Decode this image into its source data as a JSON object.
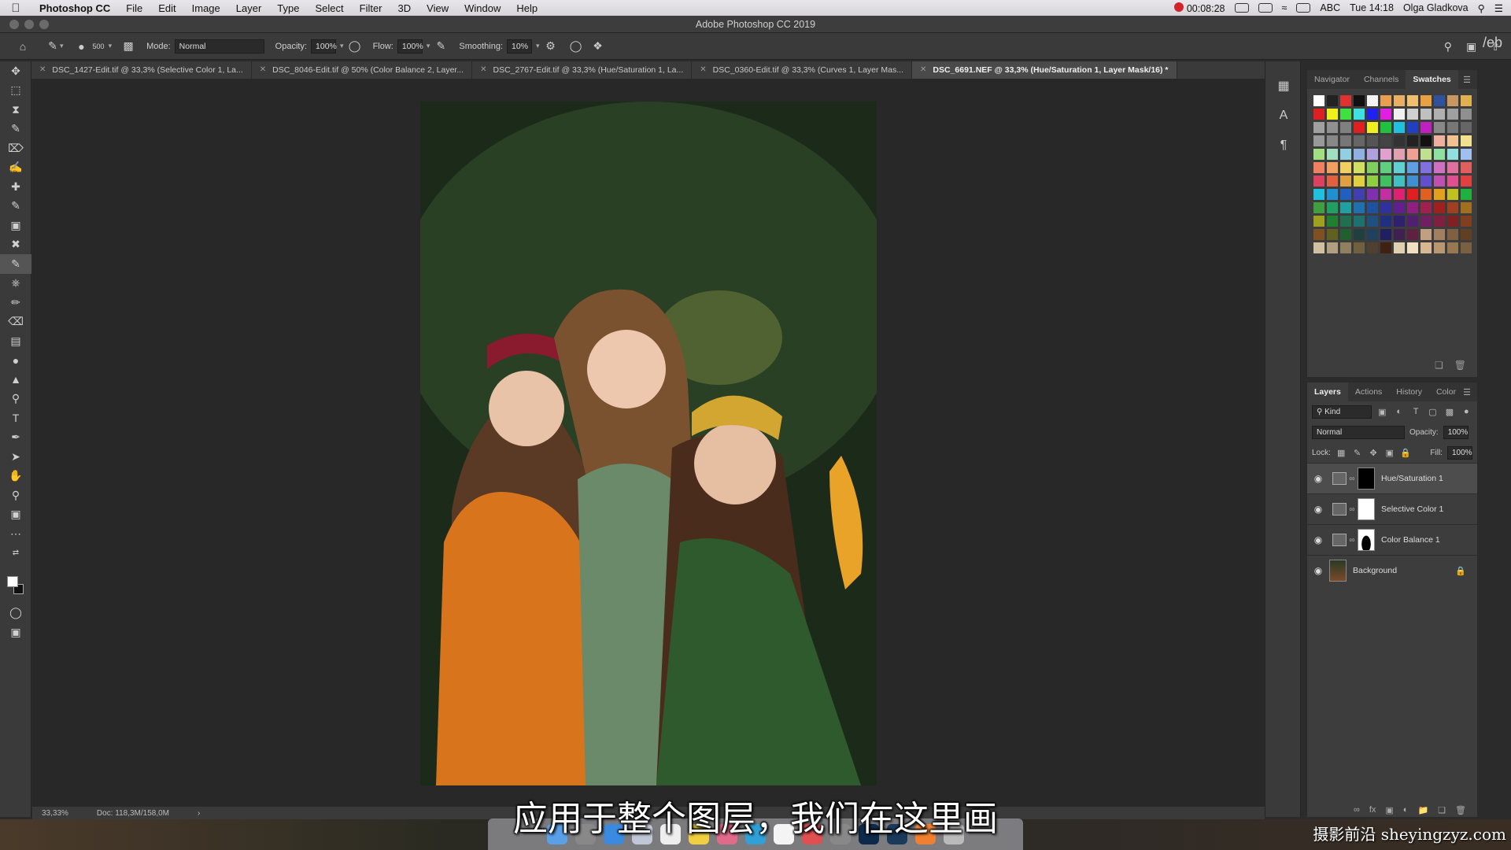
{
  "menubar": {
    "apple": "",
    "app_name": "Photoshop CC",
    "items": [
      "File",
      "Edit",
      "Image",
      "Layer",
      "Type",
      "Select",
      "Filter",
      "3D",
      "View",
      "Window",
      "Help"
    ],
    "recording_time": "00:08:28",
    "input_source": "ABC",
    "clock": "Tue 14:18",
    "user": "Olga Gladkova"
  },
  "window": {
    "title": "Adobe Photoshop CC 2019"
  },
  "options": {
    "brush_size": "500",
    "mode_label": "Mode:",
    "mode_value": "Normal",
    "opacity_label": "Opacity:",
    "opacity_value": "100%",
    "flow_label": "Flow:",
    "flow_value": "100%",
    "smoothing_label": "Smoothing:",
    "smoothing_value": "10%"
  },
  "tabs": [
    {
      "label": "DSC_1427-Edit.tif @ 33,3% (Selective Color 1, La...",
      "active": false
    },
    {
      "label": "DSC_8046-Edit.tif @ 50% (Color Balance 2, Layer...",
      "active": false
    },
    {
      "label": "DSC_2767-Edit.tif @ 33,3% (Hue/Saturation 1, La...",
      "active": false
    },
    {
      "label": "DSC_0360-Edit.tif @ 33,3% (Curves 1, Layer Mas...",
      "active": false
    },
    {
      "label": "DSC_6691.NEF @ 33,3% (Hue/Saturation 1, Layer Mask/16) *",
      "active": true
    }
  ],
  "statusbar": {
    "zoom": "33,33%",
    "doc": "Doc: 118,3M/158,0M"
  },
  "swatches_panel": {
    "tabs": [
      "Navigator",
      "Channels",
      "Swatches"
    ],
    "active_tab": "Swatches",
    "colors": [
      "#ffffff",
      "#222222",
      "#e03030",
      "#111111",
      "#f4f4f4",
      "#e8a050",
      "#e8b060",
      "#f0c070",
      "#e8a040",
      "#3050a0",
      "#c89860",
      "#e0b050",
      "#e02020",
      "#f0f020",
      "#40e040",
      "#40e0e0",
      "#2020f0",
      "#e020e0",
      "#f0f0f0",
      "#d0d0d0",
      "#c0c0c0",
      "#b0b0b0",
      "#a0a0a0",
      "#909090",
      "#a0a0a0",
      "#909090",
      "#808080",
      "#e02020",
      "#f0f020",
      "#20c040",
      "#20c0e0",
      "#2040c0",
      "#c020c0",
      "#888888",
      "#777777",
      "#666666",
      "#999999",
      "#888888",
      "#777777",
      "#666666",
      "#555555",
      "#444444",
      "#333333",
      "#222222",
      "#111111",
      "#f0b0a0",
      "#f0c090",
      "#f0e090",
      "#a0e080",
      "#a0e0c0",
      "#90d0e0",
      "#90b0e0",
      "#b0a0e0",
      "#e0a0d0",
      "#e0a0b0",
      "#f0a090",
      "#c0e090",
      "#90e0a0",
      "#90e0e0",
      "#a0c0f0",
      "#f08060",
      "#f0a060",
      "#f0d060",
      "#d0e060",
      "#80d060",
      "#60d080",
      "#60d0d0",
      "#60a0e0",
      "#8070e0",
      "#d070c0",
      "#e070a0",
      "#e06060",
      "#e04060",
      "#e06040",
      "#e0a040",
      "#e0d040",
      "#90d040",
      "#40c060",
      "#40c0c0",
      "#4090d0",
      "#6050d0",
      "#c050b0",
      "#e05090",
      "#e04040",
      "#20c0e0",
      "#2090d0",
      "#2060c0",
      "#4040b0",
      "#8030b0",
      "#c030a0",
      "#e02070",
      "#e02020",
      "#e06020",
      "#e0a020",
      "#c0c020",
      "#20b040",
      "#40a040",
      "#20a060",
      "#20a0a0",
      "#2070b0",
      "#2050a0",
      "#3030a0",
      "#602090",
      "#902080",
      "#a02050",
      "#a02020",
      "#a04020",
      "#a07020",
      "#a0a020",
      "#208030",
      "#207050",
      "#207070",
      "#205080",
      "#203080",
      "#302070",
      "#502070",
      "#702060",
      "#802040",
      "#802020",
      "#804020",
      "#805020",
      "#606020",
      "#206030",
      "#204040",
      "#204060",
      "#202060",
      "#402050",
      "#602040",
      "#c0a080",
      "#a08060",
      "#806040",
      "#604020",
      "#d0c0a0",
      "#b0a080",
      "#908060",
      "#706040",
      "#504030",
      "#402010",
      "#e0d0b0",
      "#f0e0c0",
      "#d8b890",
      "#b89870",
      "#987850",
      "#786040"
    ]
  },
  "layers_panel": {
    "tabs": [
      "Layers",
      "Actions",
      "History",
      "Color"
    ],
    "active_tab": "Layers",
    "filter_kind": "Kind",
    "blend_mode": "Normal",
    "opacity_label": "Opacity:",
    "opacity_value": "100%",
    "lock_label": "Lock:",
    "fill_label": "Fill:",
    "fill_value": "100%",
    "layers": [
      {
        "name": "Hue/Saturation 1",
        "type": "adjustment",
        "mask": "black",
        "selected": true
      },
      {
        "name": "Selective Color 1",
        "type": "adjustment",
        "mask": "white",
        "selected": false
      },
      {
        "name": "Color Balance 1",
        "type": "adjustment",
        "mask": "silhouette",
        "selected": false
      },
      {
        "name": "Background",
        "type": "image",
        "locked": true,
        "selected": false
      }
    ]
  },
  "subtitle": "应用于整个图层，我们在这里画",
  "watermark": "摄影前沿 sheyingzyz.com",
  "edge_text": "/eb"
}
